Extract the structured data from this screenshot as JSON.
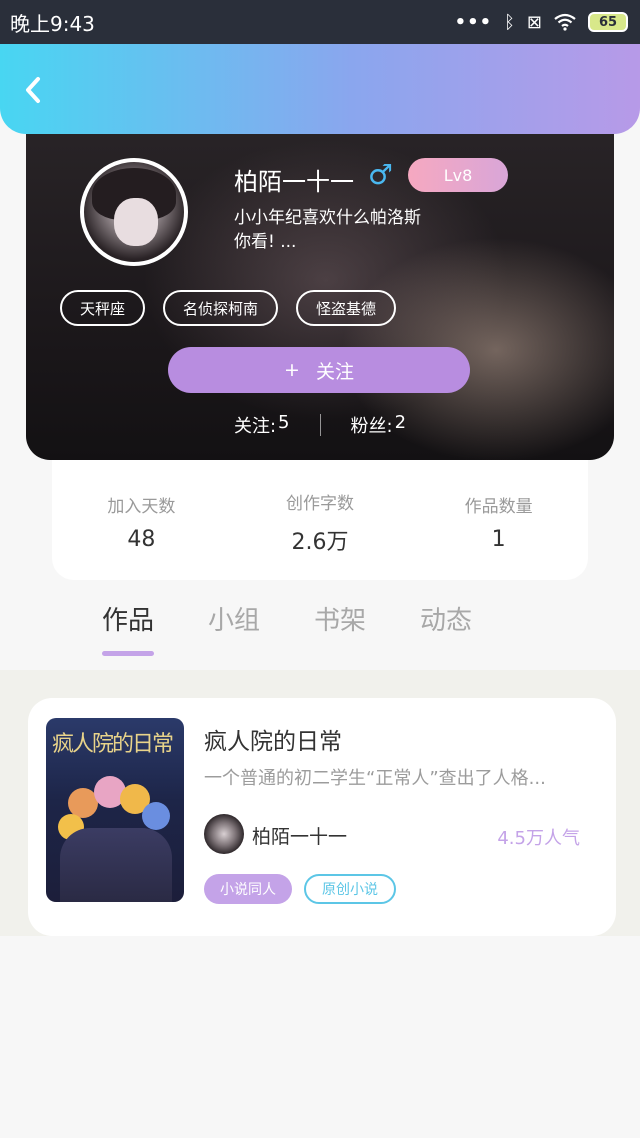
{
  "status_bar": {
    "time": "晚上9:43",
    "dots": "•••",
    "bluetooth_icon": "ᛒ",
    "sim_icon": "⊠",
    "wifi_icon": "wifi-icon",
    "battery": "65"
  },
  "header": {
    "back_icon": "chevron-left-icon"
  },
  "profile": {
    "name": "柏陌一十一",
    "gender_symbol": "♂",
    "level": "Lv8",
    "bio_line1": "小小年纪喜欢什么帕洛斯",
    "bio_line2": "你看! ...",
    "tags": [
      "天秤座",
      "名侦探柯南",
      "怪盗基德"
    ],
    "follow_plus": "+",
    "follow_label": "关注",
    "following_label": "关注:",
    "following_count": "5",
    "fans_label": "粉丝:",
    "fans_count": "2"
  },
  "stats": [
    {
      "label": "加入天数",
      "value": "48"
    },
    {
      "label": "创作字数",
      "value": "2.6万"
    },
    {
      "label": "作品数量",
      "value": "1"
    }
  ],
  "tabs": [
    "作品",
    "小组",
    "书架",
    "动态"
  ],
  "active_tab": "作品",
  "works": [
    {
      "cover_title": "疯人院的日常",
      "title": "疯人院的日常",
      "description": "一个普通的初二学生“正常人”查出了人格...",
      "author": "柏陌一十一",
      "popularity": "4.5万人气",
      "tags": [
        "小说同人",
        "原创小说"
      ]
    }
  ],
  "colors": {
    "header_gradient_start": "#48d6f2",
    "header_gradient_end": "#b79ae8",
    "accent_purple": "#c4a3e8",
    "accent_cyan": "#5cc6e6",
    "male_blue": "#4ab8f0"
  }
}
